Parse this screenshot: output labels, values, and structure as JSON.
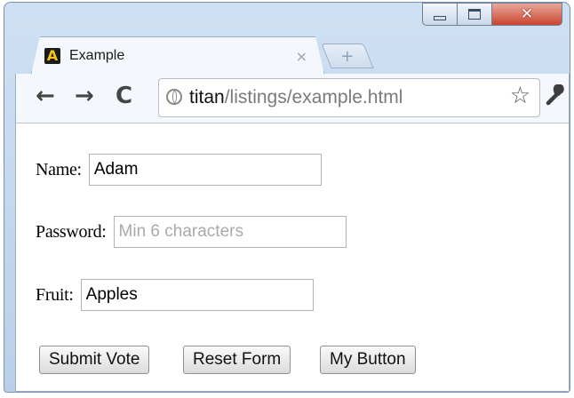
{
  "window": {
    "controls": {
      "minimize_icon": "minimize-icon",
      "maximize_icon": "maximize-icon",
      "close_glyph": "✕"
    }
  },
  "tab": {
    "favicon_letter": "A",
    "title": "Example",
    "close_glyph": "×",
    "new_tab_glyph": "+"
  },
  "toolbar": {
    "back_glyph": "←",
    "forward_glyph": "→",
    "reload_glyph": "C",
    "url_host": "titan",
    "url_path": "/listings/example.html",
    "bookmark_glyph": "☆",
    "menu_icon": "wrench-icon"
  },
  "form": {
    "name": {
      "label": "Name:",
      "value": "Adam",
      "placeholder": ""
    },
    "password": {
      "label": "Password:",
      "value": "",
      "placeholder": "Min 6 characters"
    },
    "fruit": {
      "label": "Fruit:",
      "value": "Apples",
      "placeholder": ""
    },
    "buttons": {
      "submit": "Submit Vote",
      "reset": "Reset Form",
      "custom": "My Button"
    }
  },
  "colors": {
    "window_frame": "#b9d0ea",
    "close_button": "#c9452e",
    "placeholder_text": "#a9a9a9",
    "url_path": "#7a7a7a"
  }
}
